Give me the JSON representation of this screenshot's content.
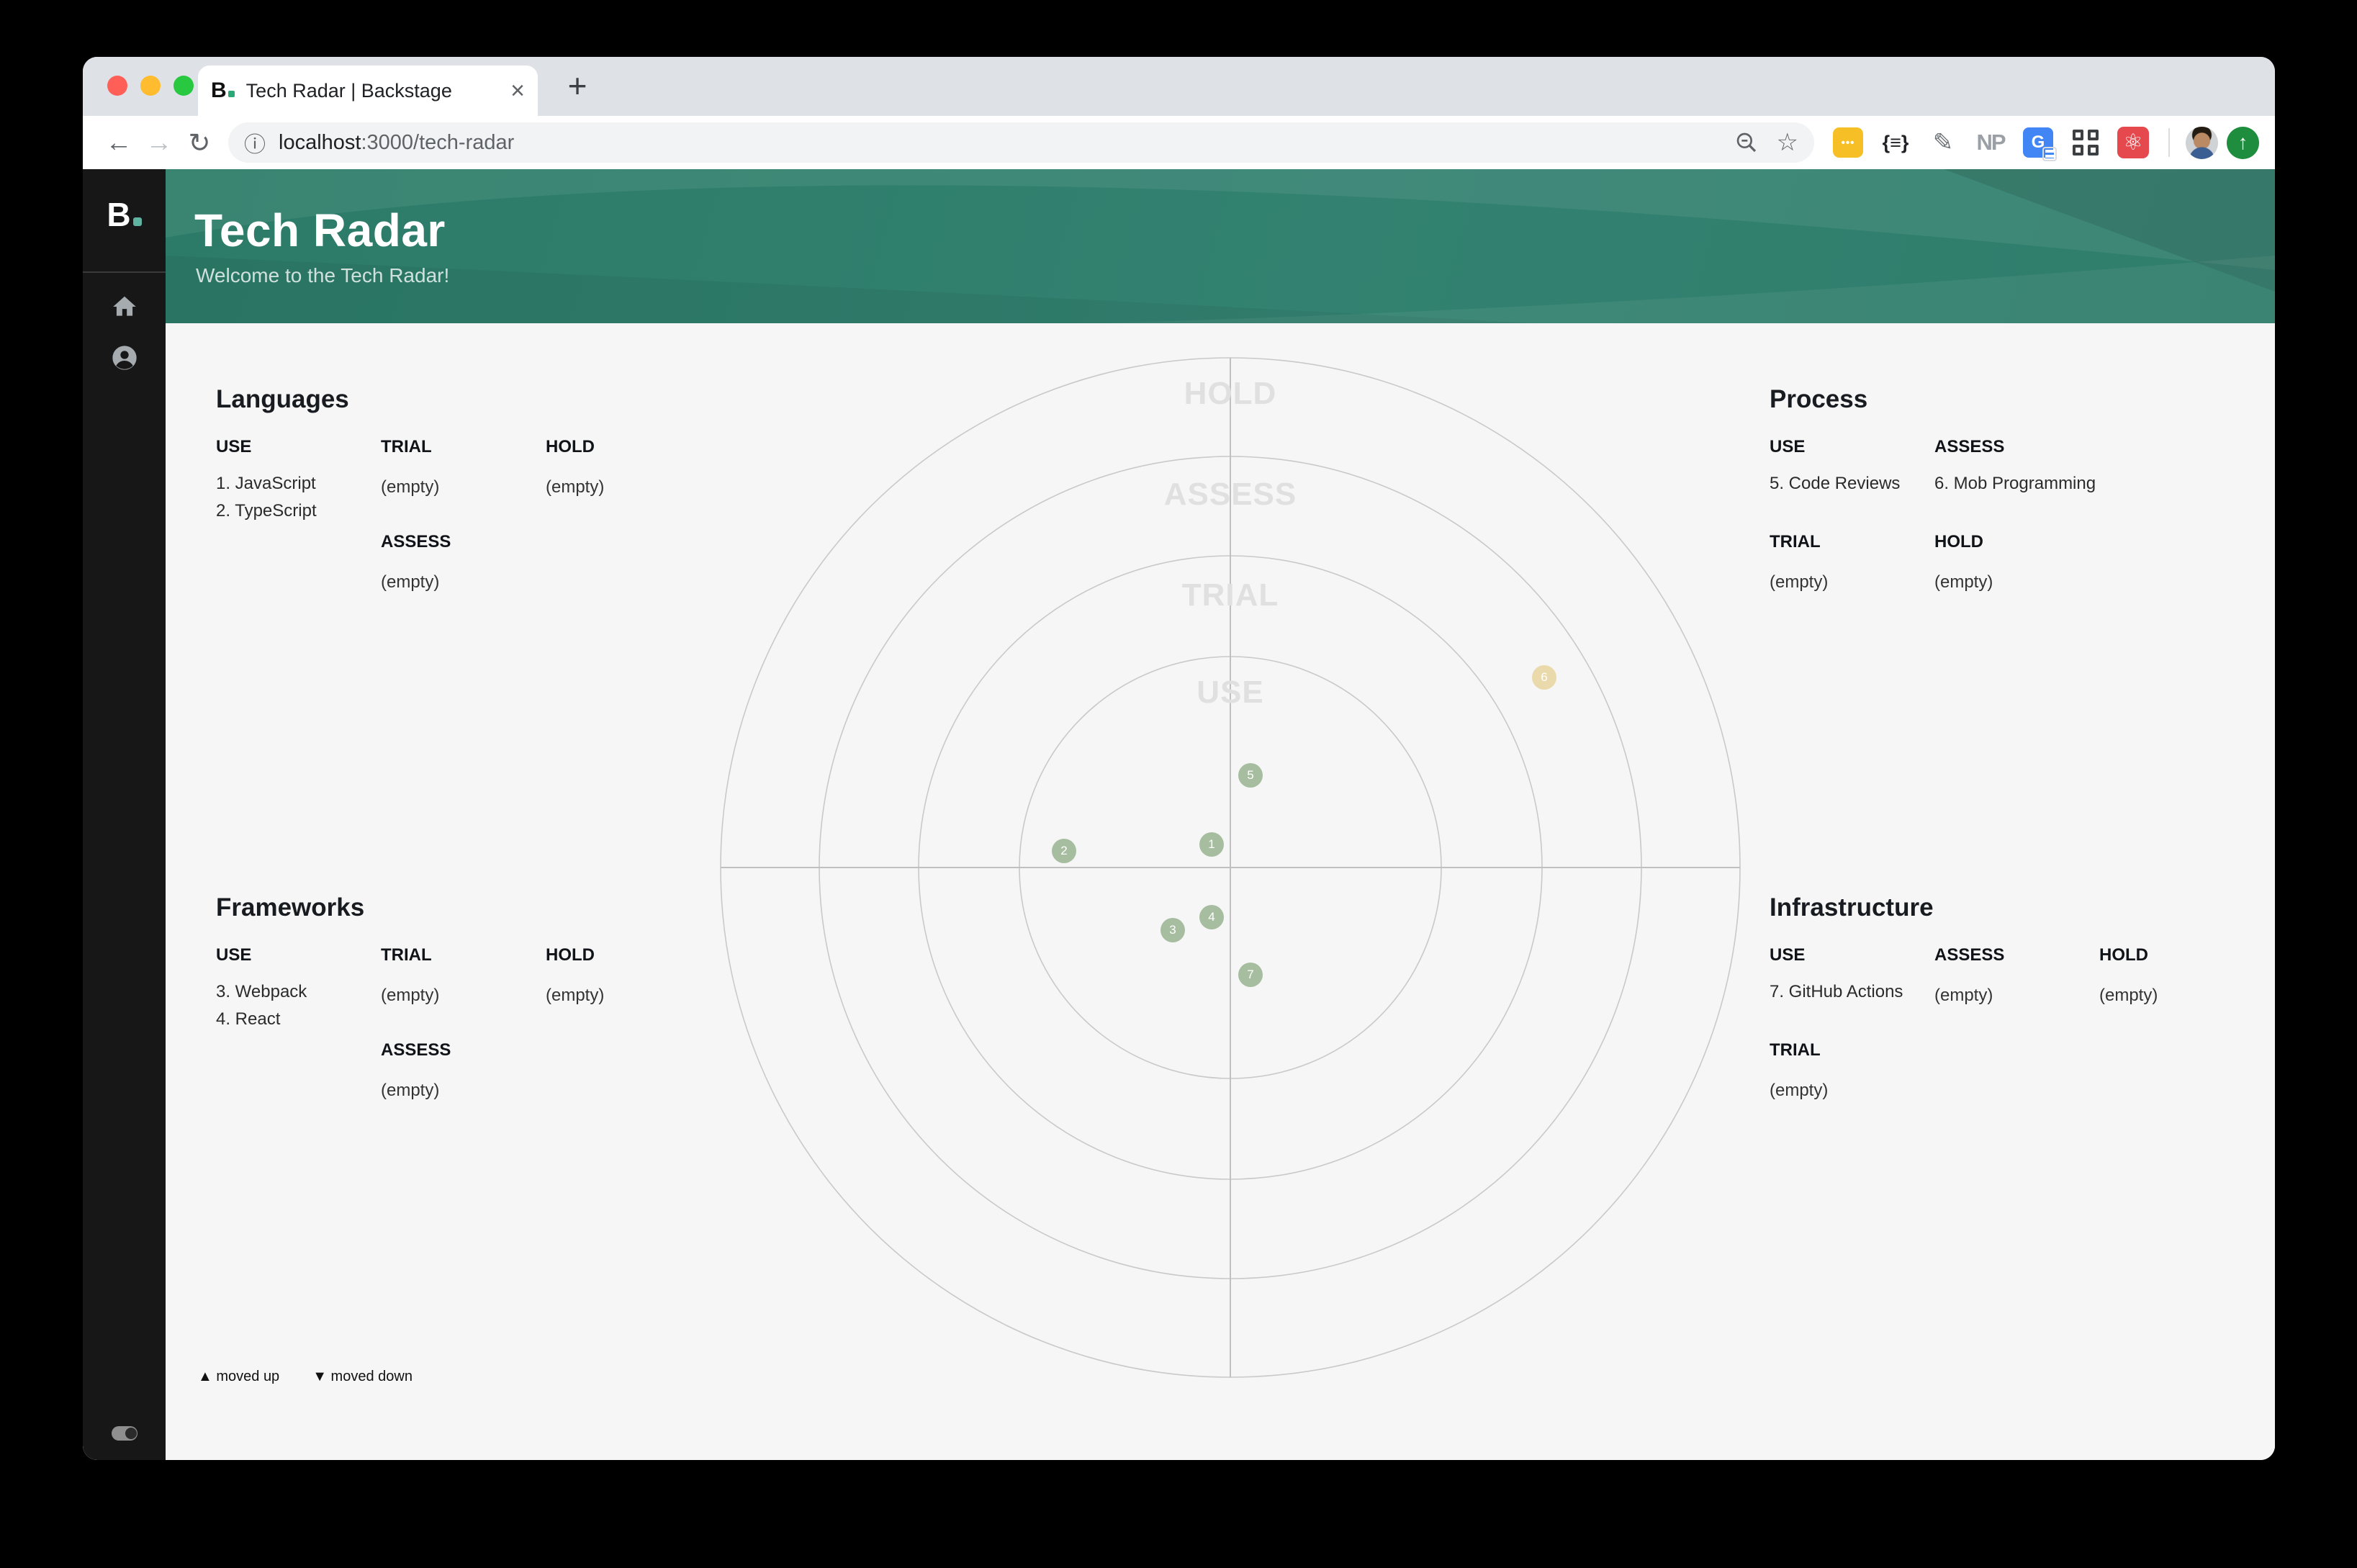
{
  "colors": {
    "header_green": "#2e7e6a",
    "sidebar_bg": "#171717",
    "blip_green": "#a6bd9f",
    "blip_tan": "#ead9ab",
    "traffic_red": "#ff5f57",
    "traffic_yellow": "#febc2e",
    "traffic_green": "#28c840"
  },
  "browser": {
    "tab_title": "Tech Radar | Backstage",
    "favicon_letter": "B",
    "close_tab_glyph": "×",
    "new_tab_glyph": "+",
    "back_glyph": "←",
    "forward_glyph": "→",
    "reload_glyph": "↻",
    "info_glyph": "ⓘ",
    "url_host": "localhost",
    "url_path": ":3000/tech-radar",
    "star_glyph": "☆",
    "extensions": [
      {
        "name": "password-manager",
        "glyph": "•••"
      },
      {
        "name": "json-formatter",
        "glyph": "{≡}"
      },
      {
        "name": "notes",
        "glyph": "✎"
      },
      {
        "name": "np",
        "glyph": "NP"
      },
      {
        "name": "translate",
        "glyph": "G"
      },
      {
        "name": "grid",
        "glyph": ""
      },
      {
        "name": "react-devtools",
        "glyph": "⚛"
      }
    ],
    "update_glyph": "↑"
  },
  "sidebar": {
    "logo_letter": "B"
  },
  "header": {
    "title": "Tech Radar",
    "subtitle": "Welcome to the Tech Radar!"
  },
  "radar": {
    "ring_labels": [
      "HOLD",
      "ASSESS",
      "TRIAL",
      "USE"
    ],
    "quadrants": {
      "languages": {
        "title": "Languages",
        "use_h": "USE",
        "use_items": [
          "1. JavaScript",
          "2. TypeScript"
        ],
        "trial_h": "TRIAL",
        "trial_empty": "(empty)",
        "assess_h": "ASSESS",
        "assess_empty": "(empty)",
        "hold_h": "HOLD",
        "hold_empty": "(empty)"
      },
      "process": {
        "title": "Process",
        "use_h": "USE",
        "use_items": [
          "5. Code Reviews"
        ],
        "assess_h": "ASSESS",
        "assess_items": [
          "6. Mob Programming"
        ],
        "trial_h": "TRIAL",
        "trial_empty": "(empty)",
        "hold_h": "HOLD",
        "hold_empty": "(empty)"
      },
      "frameworks": {
        "title": "Frameworks",
        "use_h": "USE",
        "use_items": [
          "3. Webpack",
          "4. React"
        ],
        "trial_h": "TRIAL",
        "trial_empty": "(empty)",
        "assess_h": "ASSESS",
        "assess_empty": "(empty)",
        "hold_h": "HOLD",
        "hold_empty": "(empty)"
      },
      "infrastructure": {
        "title": "Infrastructure",
        "use_h": "USE",
        "use_items": [
          "7. GitHub Actions"
        ],
        "trial_h": "TRIAL",
        "trial_empty": "(empty)",
        "assess_h": "ASSESS",
        "assess_empty": "(empty)",
        "hold_h": "HOLD",
        "hold_empty": "(empty)"
      }
    },
    "blips": [
      {
        "n": "1"
      },
      {
        "n": "2"
      },
      {
        "n": "3"
      },
      {
        "n": "4"
      },
      {
        "n": "5"
      },
      {
        "n": "6"
      },
      {
        "n": "7"
      }
    ],
    "legend_up": "▲ moved up",
    "legend_down": "▼ moved down"
  }
}
